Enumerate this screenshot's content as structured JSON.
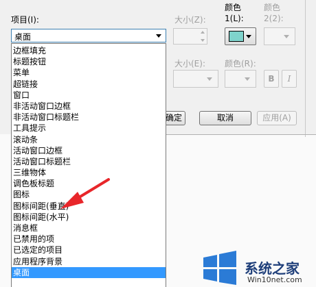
{
  "dialog": {
    "item_label": "项目(I):",
    "selected_item": "桌面",
    "size1_label": "大小(Z):",
    "color1_header": "颜色",
    "color1_label": "1(L):",
    "color2_header": "颜色",
    "color2_label": "2(2):",
    "color1_value": "#7fd3cc",
    "font_size_label": "大小(E):",
    "font_color_label": "颜色(R):",
    "bold_label": "B",
    "italic_label": "I"
  },
  "buttons": {
    "ok_partial": "确定",
    "cancel": "取消",
    "apply": "应用(A)"
  },
  "list": {
    "items": [
      "边框填充",
      "标题按钮",
      "菜单",
      "超链接",
      "窗口",
      "非活动窗口边框",
      "非活动窗口标题栏",
      "工具提示",
      "滚动条",
      "活动窗口边框",
      "活动窗口标题栏",
      "三维物体",
      "调色板标题",
      "图标",
      "图标间距(垂直)",
      "图标间距(水平)",
      "消息框",
      "已禁用的项",
      "已选定的项目",
      "应用程序背景",
      "桌面"
    ],
    "selected_index": 20
  },
  "watermark": {
    "brand": "系统之家",
    "url": "Win10net.com"
  },
  "colors": {
    "highlight": "#3399ff",
    "annotation_arrow": "#e8262a"
  }
}
